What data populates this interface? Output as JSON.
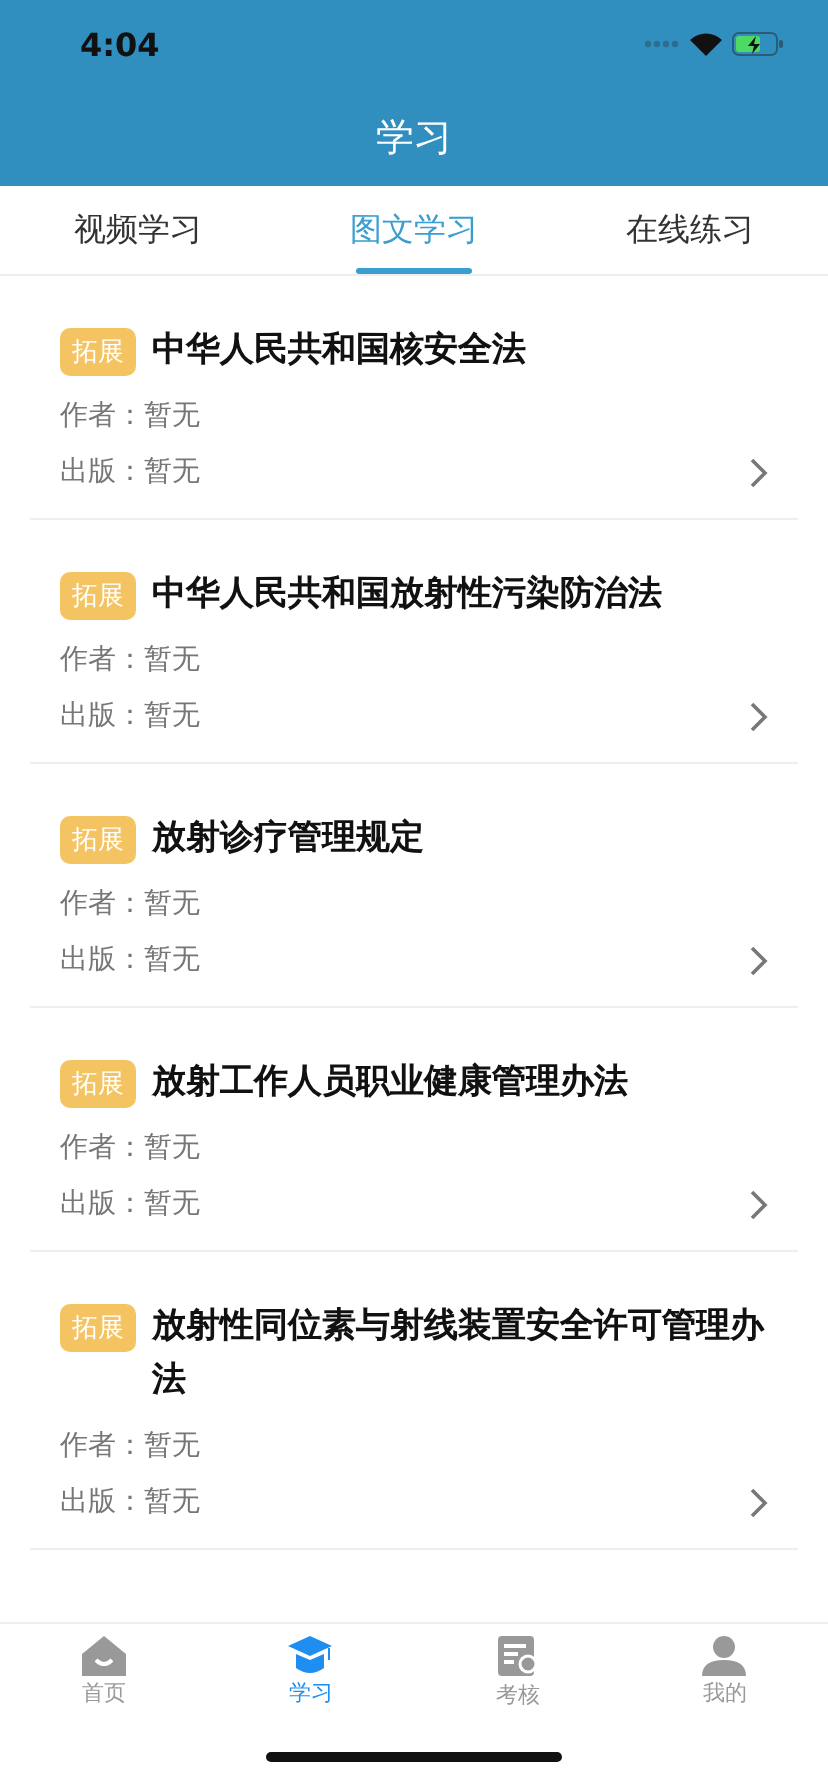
{
  "status_bar": {
    "time": "4:04"
  },
  "nav": {
    "title": "学习"
  },
  "tabs": [
    {
      "label": "视频学习",
      "selected": false
    },
    {
      "label": "图文学习",
      "selected": true
    },
    {
      "label": "在线练习",
      "selected": false
    }
  ],
  "articles": [
    {
      "tag": "拓展",
      "title": "中华人民共和国核安全法",
      "author": "作者：暂无",
      "publisher": "出版：暂无"
    },
    {
      "tag": "拓展",
      "title": "中华人民共和国放射性污染防治法",
      "author": "作者：暂无",
      "publisher": "出版：暂无"
    },
    {
      "tag": "拓展",
      "title": "放射诊疗管理规定",
      "author": "作者：暂无",
      "publisher": "出版：暂无"
    },
    {
      "tag": "拓展",
      "title": "放射工作人员职业健康管理办法",
      "author": "作者：暂无",
      "publisher": "出版：暂无"
    },
    {
      "tag": "拓展",
      "title": "放射性同位素与射线装置安全许可管理办法",
      "author": "作者：暂无",
      "publisher": "出版：暂无"
    }
  ],
  "tab_bar": [
    {
      "kind": "home",
      "label": "首页",
      "selected": false
    },
    {
      "kind": "study",
      "label": "学习",
      "selected": true
    },
    {
      "kind": "exam",
      "label": "考核",
      "selected": false
    },
    {
      "kind": "profile",
      "label": "我的",
      "selected": false
    }
  ]
}
